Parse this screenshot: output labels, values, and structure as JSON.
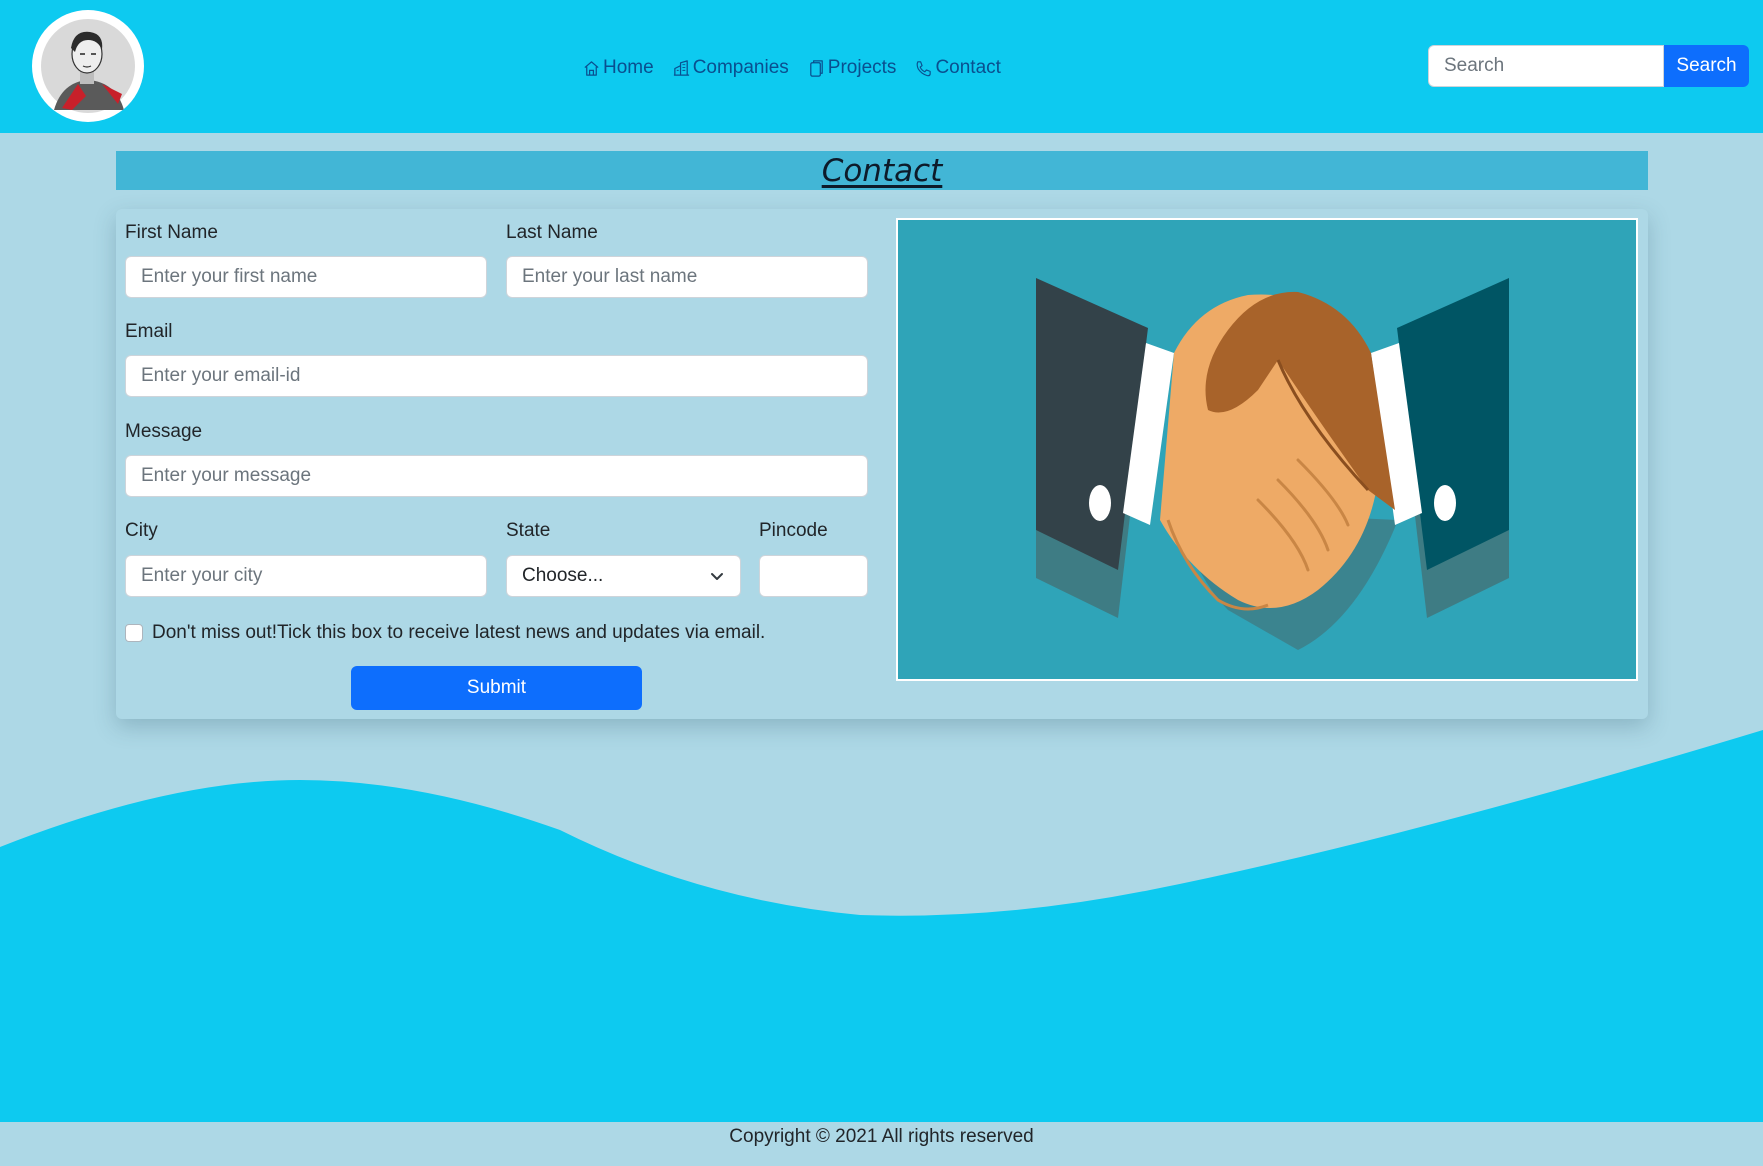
{
  "nav": {
    "links": [
      {
        "label": "Home",
        "icon": "house-icon"
      },
      {
        "label": "Companies",
        "icon": "buildings-icon"
      },
      {
        "label": "Projects",
        "icon": "files-icon"
      },
      {
        "label": "Contact",
        "icon": "phone-icon"
      }
    ],
    "search": {
      "placeholder": "Search",
      "button_label": "Search"
    }
  },
  "page": {
    "heading": "Contact"
  },
  "form": {
    "first_name": {
      "label": "First Name",
      "placeholder": "Enter your first name"
    },
    "last_name": {
      "label": "Last Name",
      "placeholder": "Enter your last name"
    },
    "email": {
      "label": "Email",
      "placeholder": "Enter your email-id"
    },
    "message": {
      "label": "Message",
      "placeholder": "Enter your message"
    },
    "city": {
      "label": "City",
      "placeholder": "Enter your city"
    },
    "state": {
      "label": "State",
      "selected": "Choose..."
    },
    "pincode": {
      "label": "Pincode",
      "placeholder": ""
    },
    "newsletter": {
      "label": "Don't miss out!Tick this box to receive latest news and updates via email.",
      "checked": false
    },
    "submit_label": "Submit"
  },
  "footer": {
    "text": "Copyright © 2021 All rights reserved"
  },
  "colors": {
    "navbar": "#0dcaf0",
    "background": "#add8e6",
    "heading_bar": "#42b6d6",
    "primary": "#0d6efd",
    "nav_link": "#0a4f8f",
    "illustration_bg": "#2fa4b8"
  }
}
